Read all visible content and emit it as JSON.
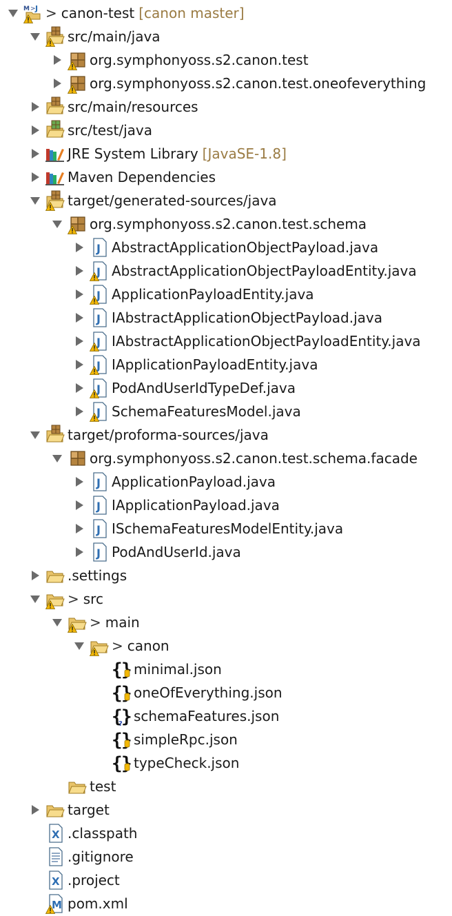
{
  "colors": {
    "decoration": "#9a7b43",
    "folder": "#e9c46a",
    "package": "#b5843f",
    "warning": "#f2b705",
    "java_blue": "#2f6fb3"
  },
  "tree": [
    {
      "depth": 0,
      "twisty": "expanded",
      "icon": "maven-project-icon",
      "prefix": ">",
      "label": "canon-test",
      "decoration": "[canon master]",
      "warn": true
    },
    {
      "depth": 1,
      "twisty": "expanded",
      "icon": "source-folder-icon",
      "label": "src/main/java",
      "warn": true
    },
    {
      "depth": 2,
      "twisty": "collapsed",
      "icon": "package-icon",
      "label": "org.symphonyoss.s2.canon.test",
      "warn": true
    },
    {
      "depth": 2,
      "twisty": "collapsed",
      "icon": "package-icon",
      "label": "org.symphonyoss.s2.canon.test.oneofeverything",
      "warn": true
    },
    {
      "depth": 1,
      "twisty": "collapsed",
      "icon": "source-folder-icon",
      "label": "src/main/resources",
      "warn": false
    },
    {
      "depth": 1,
      "twisty": "collapsed",
      "icon": "test-source-folder-icon",
      "label": "src/test/java",
      "warn": false
    },
    {
      "depth": 1,
      "twisty": "collapsed",
      "icon": "library-icon",
      "label": "JRE System Library",
      "decoration": "[JavaSE-1.8]",
      "warn": false
    },
    {
      "depth": 1,
      "twisty": "collapsed",
      "icon": "library-icon",
      "label": "Maven Dependencies",
      "warn": false
    },
    {
      "depth": 1,
      "twisty": "expanded",
      "icon": "source-folder-icon",
      "label": "target/generated-sources/java",
      "warn": true
    },
    {
      "depth": 2,
      "twisty": "expanded",
      "icon": "package-icon",
      "label": "org.symphonyoss.s2.canon.test.schema",
      "warn": true
    },
    {
      "depth": 3,
      "twisty": "collapsed",
      "icon": "java-file-icon",
      "label": "AbstractApplicationObjectPayload.java",
      "warn": false
    },
    {
      "depth": 3,
      "twisty": "collapsed",
      "icon": "java-file-icon",
      "label": "AbstractApplicationObjectPayloadEntity.java",
      "warn": true
    },
    {
      "depth": 3,
      "twisty": "collapsed",
      "icon": "java-file-icon",
      "label": "ApplicationPayloadEntity.java",
      "warn": true
    },
    {
      "depth": 3,
      "twisty": "collapsed",
      "icon": "java-file-icon",
      "label": "IAbstractApplicationObjectPayload.java",
      "warn": false
    },
    {
      "depth": 3,
      "twisty": "collapsed",
      "icon": "java-file-icon",
      "label": "IAbstractApplicationObjectPayloadEntity.java",
      "warn": true
    },
    {
      "depth": 3,
      "twisty": "collapsed",
      "icon": "java-file-icon",
      "label": "IApplicationPayloadEntity.java",
      "warn": true
    },
    {
      "depth": 3,
      "twisty": "collapsed",
      "icon": "java-file-icon",
      "label": "PodAndUserIdTypeDef.java",
      "warn": true
    },
    {
      "depth": 3,
      "twisty": "collapsed",
      "icon": "java-file-icon",
      "label": "SchemaFeaturesModel.java",
      "warn": true
    },
    {
      "depth": 1,
      "twisty": "expanded",
      "icon": "source-folder-icon",
      "label": "target/proforma-sources/java",
      "warn": false
    },
    {
      "depth": 2,
      "twisty": "expanded",
      "icon": "package-icon",
      "label": "org.symphonyoss.s2.canon.test.schema.facade",
      "warn": false
    },
    {
      "depth": 3,
      "twisty": "collapsed",
      "icon": "java-file-icon",
      "label": "ApplicationPayload.java",
      "warn": false
    },
    {
      "depth": 3,
      "twisty": "collapsed",
      "icon": "java-file-icon",
      "label": "IApplicationPayload.java",
      "warn": false
    },
    {
      "depth": 3,
      "twisty": "collapsed",
      "icon": "java-file-icon",
      "label": "ISchemaFeaturesModelEntity.java",
      "warn": false
    },
    {
      "depth": 3,
      "twisty": "collapsed",
      "icon": "java-file-icon",
      "label": "PodAndUserId.java",
      "warn": false
    },
    {
      "depth": 1,
      "twisty": "collapsed",
      "icon": "folder-icon",
      "label": ".settings",
      "warn": false
    },
    {
      "depth": 1,
      "twisty": "expanded",
      "icon": "folder-icon",
      "prefix": ">",
      "label": "src",
      "warn": true
    },
    {
      "depth": 2,
      "twisty": "expanded",
      "icon": "folder-icon",
      "prefix": ">",
      "label": "main",
      "warn": true
    },
    {
      "depth": 3,
      "twisty": "expanded",
      "icon": "folder-icon",
      "prefix": ">",
      "label": "canon",
      "warn": true
    },
    {
      "depth": 4,
      "twisty": "none",
      "icon": "json-file-icon",
      "label": "minimal.json",
      "warn": false,
      "badge": "db"
    },
    {
      "depth": 4,
      "twisty": "none",
      "icon": "json-file-icon",
      "label": "oneOfEverything.json",
      "warn": false,
      "badge": "db"
    },
    {
      "depth": 4,
      "twisty": "none",
      "icon": "json-file-icon",
      "label": "schemaFeatures.json",
      "warn": false,
      "badge": "unknown"
    },
    {
      "depth": 4,
      "twisty": "none",
      "icon": "json-file-icon",
      "label": "simpleRpc.json",
      "warn": false,
      "badge": "db"
    },
    {
      "depth": 4,
      "twisty": "none",
      "icon": "json-file-icon",
      "label": "typeCheck.json",
      "warn": false,
      "badge": "db"
    },
    {
      "depth": 2,
      "twisty": "none",
      "icon": "folder-icon",
      "label": "test",
      "warn": false
    },
    {
      "depth": 1,
      "twisty": "collapsed",
      "icon": "folder-icon",
      "label": "target",
      "warn": false
    },
    {
      "depth": 1,
      "twisty": "none",
      "icon": "xml-file-icon",
      "label": ".classpath",
      "warn": false
    },
    {
      "depth": 1,
      "twisty": "none",
      "icon": "text-file-icon",
      "label": ".gitignore",
      "warn": false
    },
    {
      "depth": 1,
      "twisty": "none",
      "icon": "xml-file-icon",
      "label": ".project",
      "warn": false
    },
    {
      "depth": 1,
      "twisty": "none",
      "icon": "maven-pom-icon",
      "label": "pom.xml",
      "warn": true
    }
  ]
}
